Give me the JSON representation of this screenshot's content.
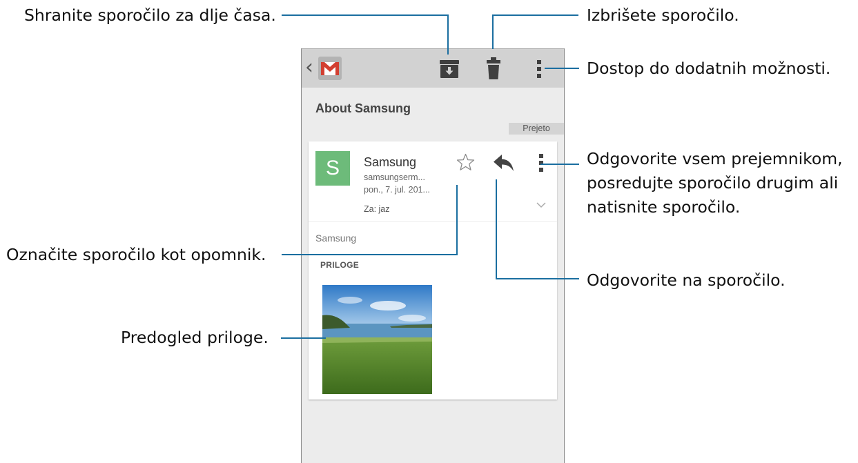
{
  "callouts": {
    "archive": "Shranite sporočilo za dlje časa.",
    "delete": "Izbrišete sporočilo.",
    "more_options": "Dostop do dodatnih možnosti.",
    "reply_all_line1": "Odgovorite vsem prejemnikom,",
    "reply_all_line2": "posredujte sporočilo drugim ali",
    "reply_all_line3": "natisnite sporočilo.",
    "star": "Označite sporočilo kot opomnik.",
    "reply": "Odgovorite na sporočilo.",
    "preview": "Predogled priloge."
  },
  "app": {
    "back_glyph": "‹",
    "logo_icon": "gmail-icon",
    "actions": [
      "archive-icon",
      "trash-icon",
      "overflow-icon"
    ]
  },
  "email": {
    "subject": "About Samsung",
    "label": "Prejeto",
    "avatar_letter": "S",
    "sender": "Samsung",
    "sender_email": "samsungserm...",
    "date": "pon., 7. jul. 201...",
    "recipient": "Za: jaz",
    "body": "Samsung",
    "attachments_header": "PRILOGE"
  },
  "colors": {
    "leader_line": "#1a6ea0",
    "action_bar": "#d2d2d2",
    "avatar": "#6dbb7a",
    "gmail_red": "#d23f31"
  }
}
